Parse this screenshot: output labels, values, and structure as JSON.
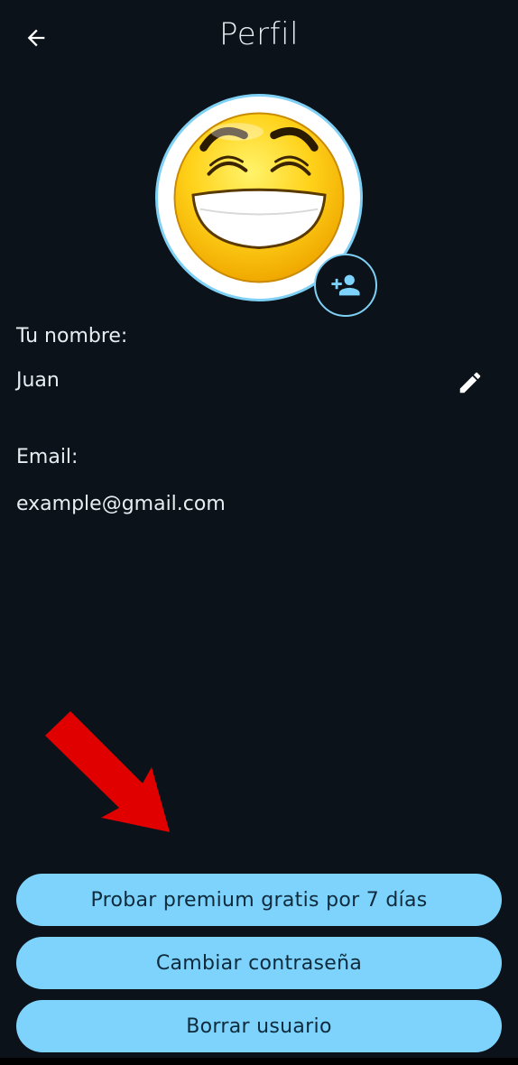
{
  "header": {
    "title": "Perfil",
    "back_icon": "arrow-back-icon"
  },
  "avatar": {
    "image": "grinning-emoji",
    "add_icon": "person-add-icon"
  },
  "profile": {
    "name_label": "Tu nombre:",
    "name_value": "Juan",
    "edit_icon": "pencil-icon",
    "email_label": "Email:",
    "email_value": "example@gmail.com"
  },
  "annotation": {
    "arrow_color": "#e00000"
  },
  "actions": {
    "premium_label": "Probar premium gratis por 7 días",
    "change_password_label": "Cambiar contraseña",
    "delete_user_label": "Borrar usuario"
  },
  "colors": {
    "background": "#0b121a",
    "accent": "#7dd3fb",
    "button_text": "#0e2a3c"
  }
}
